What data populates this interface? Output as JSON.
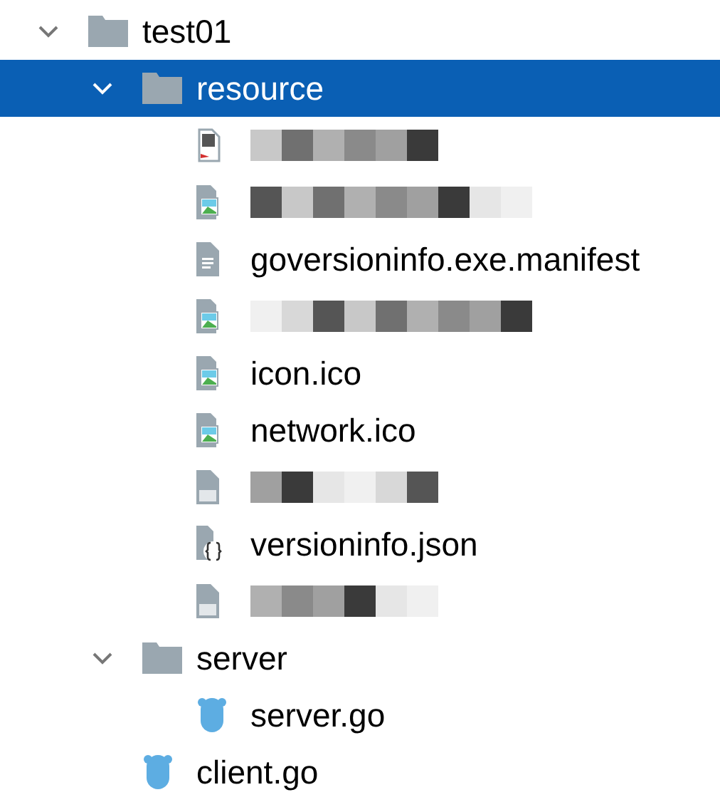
{
  "tree": [
    {
      "name": "test01",
      "kind": "folder",
      "expanded": true,
      "selected": false,
      "children": [
        {
          "name": "resource",
          "kind": "folder",
          "expanded": true,
          "selected": true,
          "children": [
            {
              "kind": "pdf",
              "redacted": true,
              "selected": false
            },
            {
              "kind": "image",
              "redacted": true,
              "selected": false
            },
            {
              "name": "goversioninfo.exe.manifest",
              "kind": "text",
              "redacted": false,
              "selected": false
            },
            {
              "kind": "image",
              "redacted": true,
              "selected": false
            },
            {
              "name": "icon.ico",
              "kind": "image",
              "redacted": false,
              "selected": false
            },
            {
              "name": "network.ico",
              "kind": "image",
              "redacted": false,
              "selected": false
            },
            {
              "kind": "file",
              "redacted": true,
              "selected": false
            },
            {
              "name": "versioninfo.json",
              "kind": "json",
              "redacted": false,
              "selected": false
            },
            {
              "kind": "file",
              "redacted": true,
              "selected": false
            }
          ]
        },
        {
          "name": "server",
          "kind": "folder",
          "expanded": true,
          "selected": false,
          "children": [
            {
              "name": "server.go",
              "kind": "go",
              "redacted": false,
              "selected": false
            }
          ]
        },
        {
          "name": "client.go",
          "kind": "go",
          "redacted": false,
          "selected": false
        }
      ]
    }
  ]
}
